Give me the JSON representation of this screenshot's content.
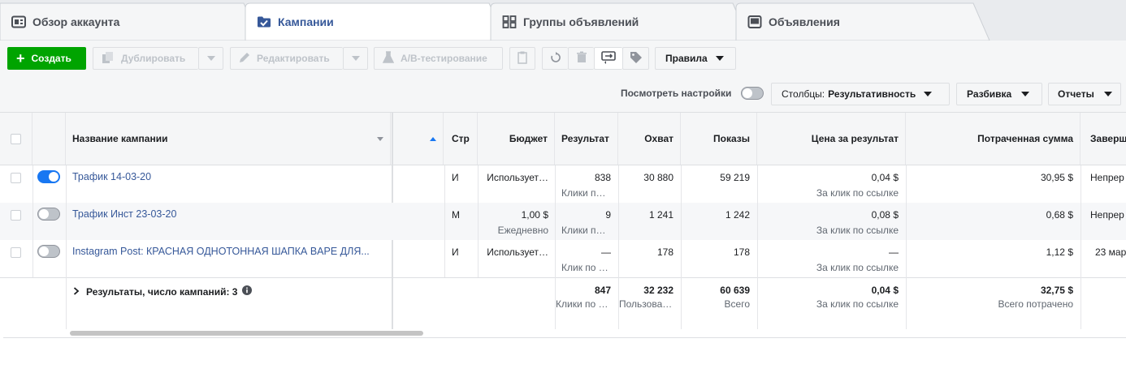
{
  "tabs": [
    {
      "label": "Обзор аккаунта",
      "icon": "account-overview-icon"
    },
    {
      "label": "Кампании",
      "icon": "campaign-folder-icon",
      "active": true
    },
    {
      "label": "Группы объявлений",
      "icon": "ad-sets-grid-icon"
    },
    {
      "label": "Объявления",
      "icon": "ads-monitor-icon"
    }
  ],
  "toolbar": {
    "create": "Создать",
    "duplicate": "Дублировать",
    "edit": "Редактировать",
    "ab_test": "A/B-тестирование",
    "rules": "Правила"
  },
  "view_bar": {
    "view_settings": "Посмотреть настройки",
    "columns_prefix": "Столбцы:",
    "columns_value": "Результативность",
    "breakdown": "Разбивка",
    "reports": "Отчеты"
  },
  "table": {
    "headers": {
      "name": "Название кампании",
      "delivery": "Стр",
      "budget": "Бюджет",
      "results": "Результат",
      "reach": "Охват",
      "impressions": "Показы",
      "cost_per_result": "Цена за результат",
      "amount_spent": "Потраченная сумма",
      "ends": "Заверш"
    },
    "rows": [
      {
        "active": true,
        "name": "Трафик 14-03-20",
        "delivery": "И",
        "budget": "Использует…",
        "budget_sub": "",
        "results": "838",
        "results_sub": "Клики п…",
        "reach": "30 880",
        "impressions": "59 219",
        "cost": "0,04 $",
        "cost_sub": "За клик по ссылке",
        "spent": "30,95 $",
        "ends": "Непрер"
      },
      {
        "active": false,
        "name": "Трафик Инст 23-03-20",
        "delivery": "М",
        "budget": "1,00 $",
        "budget_sub": "Ежедневно",
        "results": "9",
        "results_sub": "Клики п…",
        "reach": "1 241",
        "impressions": "1 242",
        "cost": "0,08 $",
        "cost_sub": "За клик по ссылке",
        "spent": "0,68 $",
        "ends": "Непрер"
      },
      {
        "active": false,
        "name": "Instagram Post: КРАСНАЯ ОДНОТОННАЯ ШАПКА BAPE ДЛЯ...",
        "delivery": "И",
        "budget": "Использует…",
        "budget_sub": "",
        "results": "—",
        "results_sub": "Клик по …",
        "reach": "178",
        "impressions": "178",
        "cost": "—",
        "cost_sub": "За клик по ссылке",
        "spent": "1,12 $",
        "ends": "23 мар"
      }
    ],
    "summary": {
      "label": "Результаты, число кампаний: 3",
      "results": "847",
      "results_sub": "Клики по …",
      "reach": "32 232",
      "reach_sub": "Пользова…",
      "impressions": "60 639",
      "impressions_sub": "Всего",
      "cost": "0,04 $",
      "cost_sub": "За клик по ссылке",
      "spent": "32,75 $",
      "spent_sub": "Всего потрачено"
    }
  },
  "colors": {
    "primary_green": "#00a400",
    "link_blue": "#365899",
    "toggle_on": "#1877f2"
  }
}
